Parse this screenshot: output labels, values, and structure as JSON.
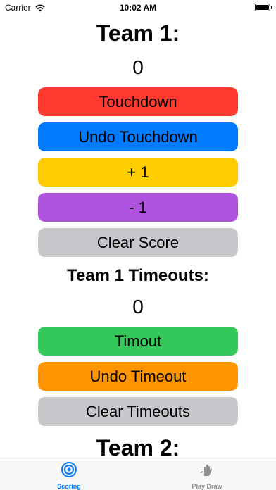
{
  "status_bar": {
    "carrier": "Carrier",
    "time": "10:02 AM"
  },
  "team1": {
    "title": "Team 1:",
    "score": "0",
    "buttons": {
      "touchdown": "Touchdown",
      "undo_touchdown": "Undo Touchdown",
      "plus_one": "+ 1",
      "minus_one": "- 1",
      "clear_score": "Clear Score"
    },
    "timeouts_title": "Team 1 Timeouts:",
    "timeouts": "0",
    "timeout_buttons": {
      "timeout": "Timout",
      "undo_timeout": "Undo Timeout",
      "clear_timeouts": "Clear Timeouts"
    }
  },
  "team2": {
    "title": "Team 2:"
  },
  "tab_bar": {
    "tabs": [
      {
        "label": "Scoring",
        "icon": "target-icon",
        "selected": true
      },
      {
        "label": "Play Draw",
        "icon": "hand-draw-icon",
        "selected": false
      }
    ]
  },
  "colors": {
    "touchdown": "#ff3b30",
    "undo_touchdown": "#007aff",
    "plus_one": "#ffcc00",
    "minus_one": "#af52de",
    "clear": "#c7c7cc",
    "timeout": "#34c759",
    "undo_timeout": "#ff9500",
    "tab_active": "#007aff",
    "tab_inactive": "#8e8e93"
  }
}
